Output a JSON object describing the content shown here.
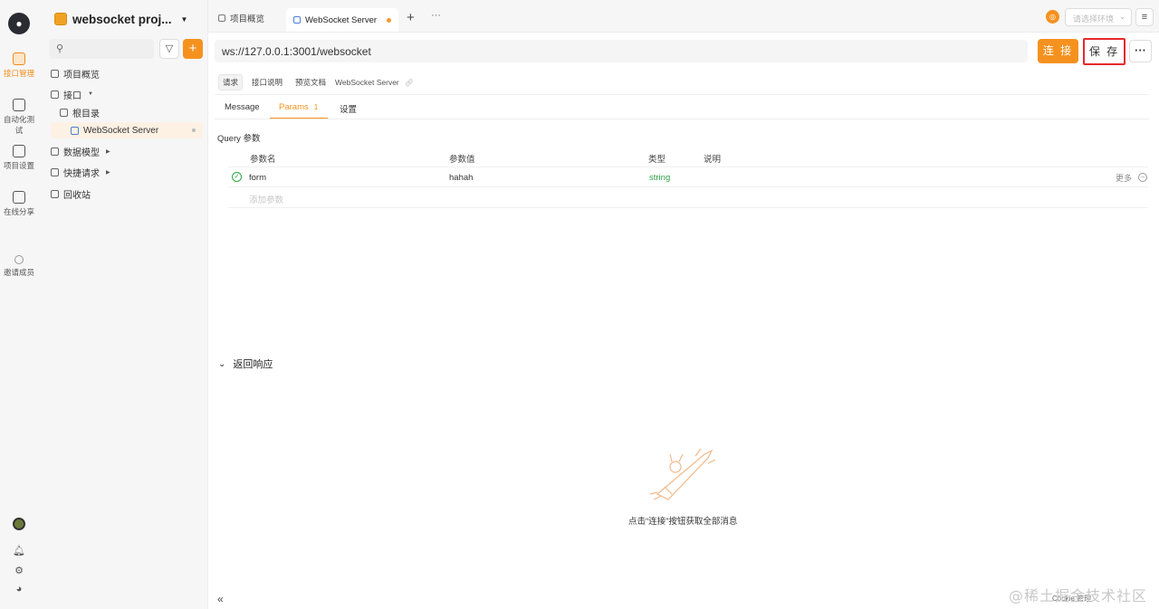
{
  "rail": {
    "items": [
      {
        "label": "接口管理",
        "active": true
      },
      {
        "label": "自动化测试"
      },
      {
        "label": "项目设置"
      },
      {
        "label": "在线分享"
      },
      {
        "label": "邀请成员"
      }
    ]
  },
  "sidebar": {
    "project_name": "websocket proj...",
    "search_placeholder": "",
    "tree": {
      "overview": "项目概览",
      "interfaces": "接口",
      "root": "根目录",
      "ws_server": "WebSocket Server",
      "data_models": "数据模型",
      "quick_requests": "快捷请求",
      "recycle": "回收站"
    }
  },
  "tabs": {
    "overview": "项目概览",
    "active": "WebSocket Server",
    "env_placeholder": "请选择环境"
  },
  "request": {
    "url": "ws://127.0.0.1:3001/websocket",
    "connect_label": "连 接",
    "save_label": "保 存"
  },
  "subtabs": {
    "request": "请求",
    "doc": "接口说明",
    "preview": "预览文档",
    "title": "WebSocket Server"
  },
  "params_tabs": {
    "message": "Message",
    "params": "Params",
    "params_count": "1",
    "settings": "设置"
  },
  "query": {
    "label": "Query 参数",
    "headers": {
      "name": "参数名",
      "value": "参数值",
      "type": "类型",
      "desc": "说明"
    },
    "rows": [
      {
        "name": "form",
        "value": "hahah",
        "type": "string",
        "desc": ""
      }
    ],
    "more_label": "更多",
    "add_placeholder": "添加参数"
  },
  "response": {
    "title": "返回响应",
    "empty_text": "点击“连接”按钮获取全部消息"
  },
  "footer": {
    "cookie": "Cookie 管理",
    "watermark": "@稀土掘金技术社区"
  },
  "colors": {
    "accent": "#f5921f",
    "highlight_border": "#e5292c",
    "type_green": "#2ea043"
  }
}
